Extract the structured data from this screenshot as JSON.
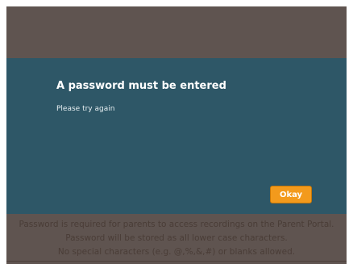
{
  "dialog": {
    "title": "A password must be entered",
    "message": "Please try again",
    "ok_label": "Okay"
  },
  "background_notes": [
    "Password is required for parents to access recordings on the Parent Portal.",
    "Password will be stored as all lower case characters.",
    "No special characters (e.g. @,%,&,#) or blanks allowed."
  ],
  "colors": {
    "overlay": "#5f5450",
    "dialog": "#2e5767",
    "button": "#f39a1c"
  }
}
